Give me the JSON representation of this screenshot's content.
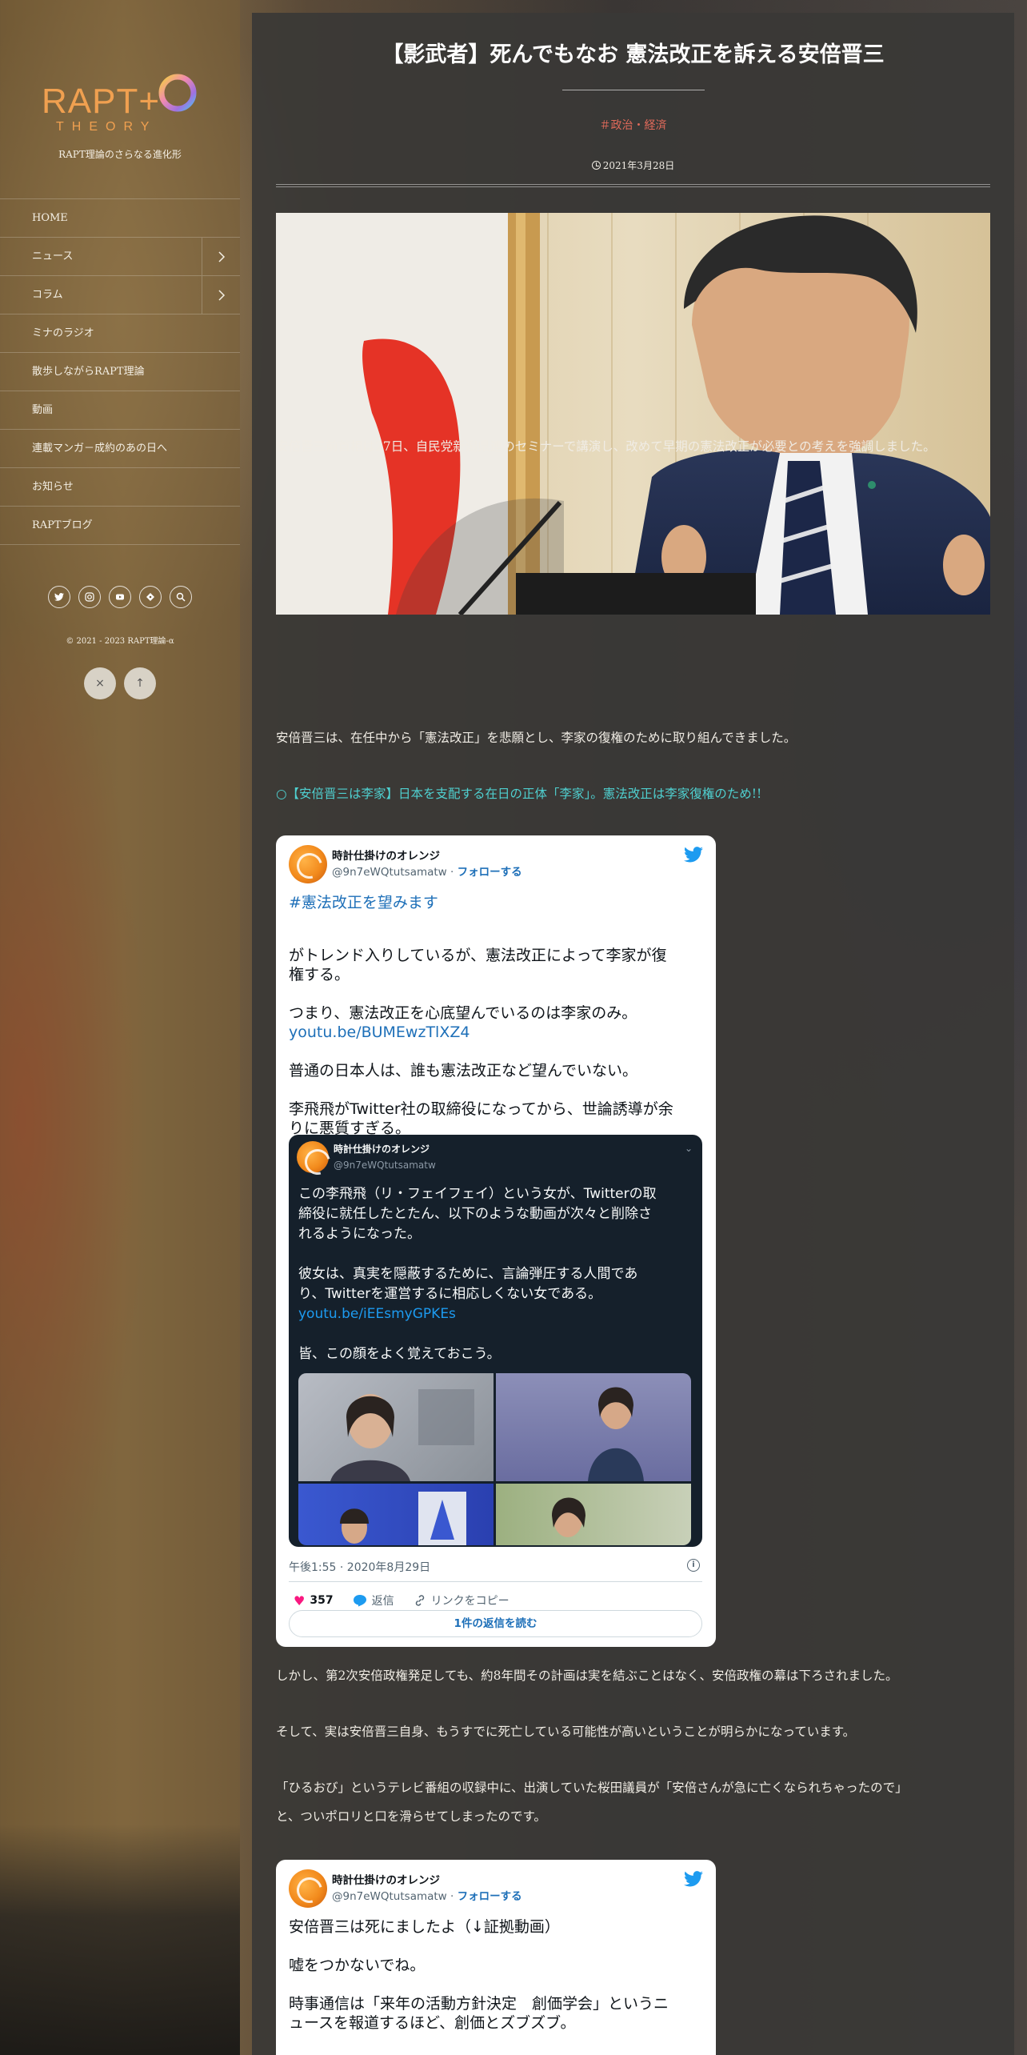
{
  "site": {
    "logo_text": "RAPT+",
    "logo_sub": "THEORY",
    "tagline": "RAPT理論のさらなる進化形",
    "copyright": "© 2021 - 2023 RAPT理論-α"
  },
  "nav": {
    "items": [
      {
        "label": "HOME"
      },
      {
        "label": "ニュース"
      },
      {
        "label": "コラム"
      },
      {
        "label": "ミナのラジオ"
      },
      {
        "label": "散歩しながらRAPT理論"
      },
      {
        "label": "動画"
      },
      {
        "label": "連載マンガ－成約のあの日へ"
      },
      {
        "label": "お知らせ"
      },
      {
        "label": "RAPTブログ"
      }
    ]
  },
  "social": {
    "icons": [
      "twitter-icon",
      "instagram-icon",
      "youtube-icon",
      "tag-icon",
      "search-icon"
    ]
  },
  "controls": {
    "close": "×",
    "top": "↑"
  },
  "article": {
    "title": "【影武者】死んでもなお 憲法改正を訴える安倍晋三",
    "category": "＃政治・経済",
    "date": "2021年3月28日",
    "p1": "安倍晋三前首相は27日、自民党新潟県連のセミナーで講演し、改めて早期の憲法改正が必要との考えを強調しました。",
    "p2": "安倍晋三は、在任中から「憲法改正」を悲願とし、李家の復権のために取り組んできました。",
    "link1": "○【安倍晋三は李家】日本を支配する在日の正体「李家」。憲法改正は李家復権のため!!",
    "p3": "しかし、第2次安倍政権発足しても、約8年間その計画は実を結ぶことはなく、安倍政権の幕は下ろされました。",
    "p4": "そして、実は安倍晋三自身、もうすでに死亡している可能性が高いということが明らかになっています。",
    "p5a": "「ひるおび」というテレビ番組の収録中に、出演していた桜田議員が「安倍さんが急に亡くなられちゃったので」",
    "p5b": "と、ついポロリと口を滑らせてしまったのです。"
  },
  "tweet1": {
    "name": "時計仕掛けのオレンジ",
    "handle": "@9n7eWQtutsamatw",
    "follow": "フォローする",
    "hashtag": "#憲法改正を望みます",
    "l1": "がトレンド入りしているが、憲法改正によって李家が復",
    "l2": "権する。",
    "l3": "つまり、憲法改正を心底望んでいるのは李家のみ。",
    "link": "youtu.be/BUMEwzTlXZ4",
    "l4": "普通の日本人は、誰も憲法改正など望んでいない。",
    "l5": "李飛飛がTwitter社の取締役になってから、世論誘導が余",
    "l6": "りに悪質すぎる。",
    "quote": {
      "name": "時計仕掛けのオレンジ",
      "handle": "@9n7eWQtutsamatw",
      "l1": "この李飛飛（リ・フェイフェイ）という女が、Twitterの取",
      "l2": "締役に就任したとたん、以下のような動画が次々と削除さ",
      "l3": "れるようになった。",
      "l4": "彼女は、真実を隠蔽するために、言論弾圧する人間であ",
      "l5": "り、Twitterを運営するに相応しくない女である。",
      "link": "youtu.be/iEEsmyGPKEs",
      "l6": "皆、この顔をよく覚えておこう。"
    },
    "timestamp": "午後1:55 · 2020年8月29日",
    "likes": "357",
    "reply": "返信",
    "copy_link": "リンクをコピー",
    "read_replies": "1件の返信を読む"
  },
  "tweet2": {
    "name": "時計仕掛けのオレンジ",
    "handle": "@9n7eWQtutsamatw",
    "follow": "フォローする",
    "l1": "安倍晋三は死にましたよ（↓証拠動画）",
    "l2": "嘘をつかないでね。",
    "l3": "時事通信は「来年の活動方針決定　創価学会」というニ",
    "l4": "ュースを報道するほど、創価とズブズブ。"
  }
}
